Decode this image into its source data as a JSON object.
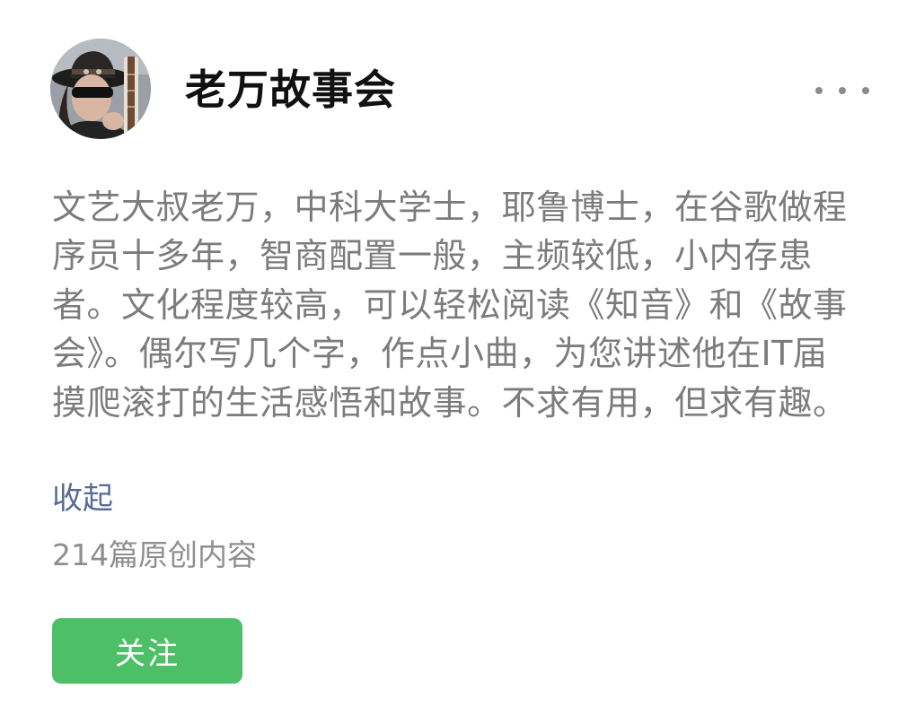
{
  "account": {
    "name": "老万故事会",
    "avatar_icon": "avatar-photo"
  },
  "header": {
    "more_icon": "more-dots-icon"
  },
  "profile": {
    "description": "文艺大叔老万，中科大学士，耶鲁博士，在谷歌做程序员十多年，智商配置一般，主频较低，小内存患者。文化程度较高，可以轻松阅读《知音》和《故事会》。偶尔写几个字，作点小曲，为您讲述他在IT届摸爬滚打的生活感悟和故事。不求有用，但求有趣。",
    "collapse_label": "收起",
    "article_count": "214篇原创内容"
  },
  "actions": {
    "follow_label": "关注"
  },
  "colors": {
    "link": "#576b95",
    "follow_button": "#4dbf67",
    "description_text": "#7c7c7c"
  }
}
